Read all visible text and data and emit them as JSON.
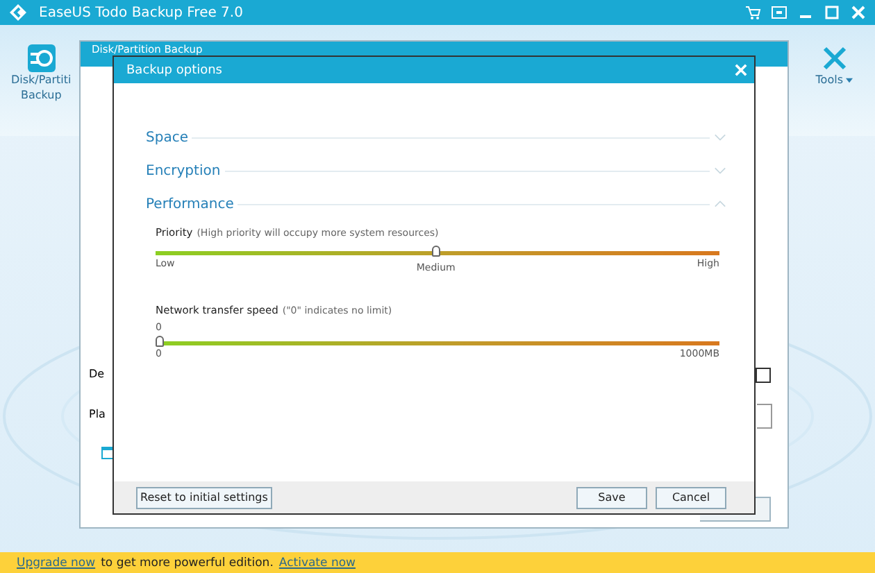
{
  "app_window": {
    "title": "EaseUS Todo Backup Free 7.0",
    "toolbar_left": {
      "lines": [
        "Disk/Partiti",
        "Backup"
      ]
    },
    "toolbar_right": {
      "label": "Tools"
    }
  },
  "backup_window": {
    "title": "Disk/Partition Backup",
    "labels": [
      "De",
      "Pla"
    ],
    "checkbox": {
      "checked": false
    }
  },
  "dialog": {
    "title": "Backup options",
    "sections": [
      {
        "label": "Space",
        "expanded": false
      },
      {
        "label": "Encryption",
        "expanded": false
      },
      {
        "label": "Performance",
        "expanded": true
      }
    ],
    "priority": {
      "label": "Priority",
      "hint": "(High priority will occupy more system resources)",
      "level": 0.5,
      "ticks": [
        "Low",
        "Medium",
        "High"
      ]
    },
    "network": {
      "label": "Network transfer speed",
      "hint": "(\"0\" indicates no limit)",
      "value": "0",
      "level": 0,
      "min": "0",
      "max": "1000MB"
    },
    "buttons": {
      "reset": "Reset to initial settings",
      "save": "Save",
      "cancel": "Cancel"
    }
  },
  "banner": {
    "link_1": "Upgrade now",
    "text": "to get more powerful edition.",
    "link_2": "Activate now"
  }
}
